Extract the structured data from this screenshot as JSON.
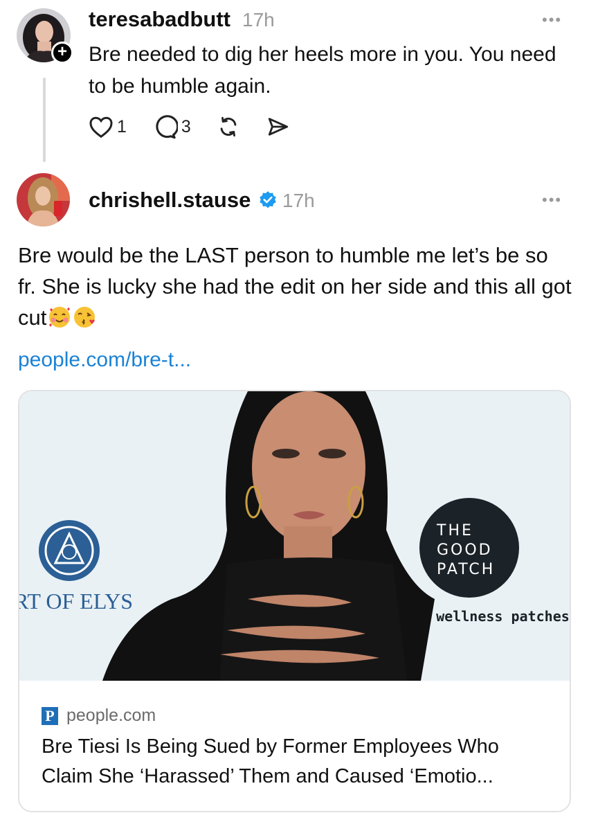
{
  "post1": {
    "username": "teresabadbutt",
    "time": "17h",
    "more": "•••",
    "plus": "+",
    "text": "Bre needed to dig her heels more in you. You need to be humble again.",
    "actions": {
      "like_icon": "heart-icon",
      "like_count": "1",
      "reply_icon": "comment-icon",
      "reply_count": "3",
      "repost_icon": "repost-icon",
      "share_icon": "send-icon"
    }
  },
  "post2": {
    "username": "chrishell.stause",
    "verified_icon": "verified-badge-icon",
    "time": "17h",
    "more": "•••",
    "text": "Bre would be the LAST person to humble me let’s be so fr. She is lucky she had the edit on her side and this all got cut",
    "emojis": [
      "smiling-face-with-hearts-emoji",
      "kissing-face-emoji"
    ],
    "link": "people.com/bre-t..."
  },
  "card": {
    "image_texts": {
      "left_logo_text": "RT OF ELYS",
      "badge_line1": "THE",
      "badge_line2": "GOOD",
      "badge_line3": "PATCH",
      "wellness": "le wellness patches"
    },
    "source_logo": "P",
    "source": "people.com",
    "title": "Bre Tiesi Is Being Sued by Former Employees Who Claim She ‘Harassed’ Them and Caused ‘Emotio..."
  },
  "colors": {
    "link": "#1a82d6",
    "verified": "#1d9bf0",
    "muted": "#9a9a9a",
    "people_brand": "#1e6fb8"
  }
}
